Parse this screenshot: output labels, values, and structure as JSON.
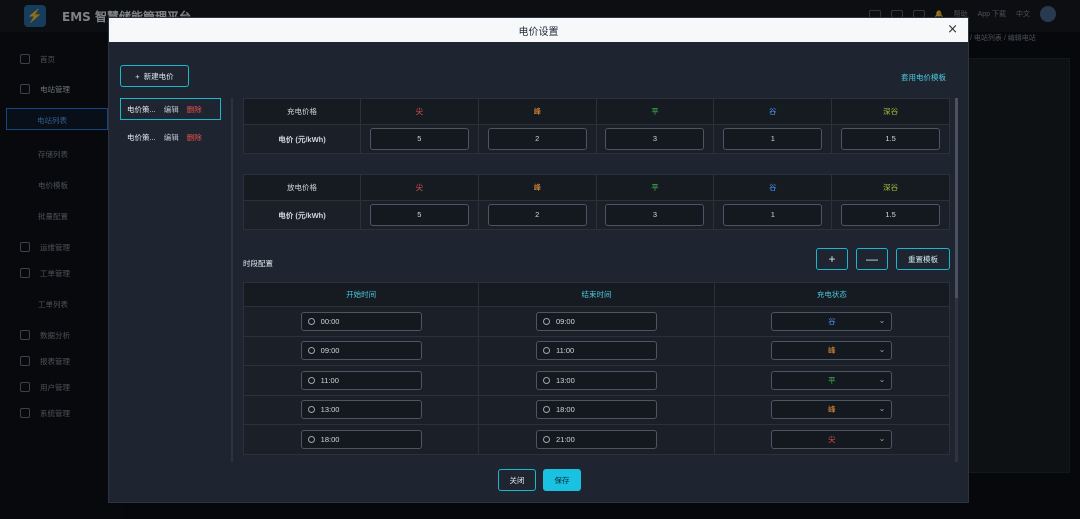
{
  "topbar": {
    "title": "EMS 智慧储能管理平台",
    "buttons": [
      "",
      "",
      ""
    ],
    "help": "帮助",
    "app": "App 下载",
    "lang": "中文"
  },
  "sidebar": {
    "home": "首页",
    "station_mgmt": "电站管理",
    "station_list": "电站列表",
    "storage_list": "存储列表",
    "price_template": "电价模板",
    "batch_config": "批量配置",
    "ops_mgmt": "运维管理",
    "work_order": "工单管理",
    "work_order_list": "工单列表",
    "data_analysis": "数据分析",
    "report_mgmt": "报表管理",
    "user_mgmt": "用户管理",
    "system_mgmt": "系统管理"
  },
  "breadcrumb": "/ 电站列表 / 编辑电站",
  "modal": {
    "title": "电价设置",
    "close": "×",
    "new_price": "新建电价",
    "apply_template": "套用电价模板",
    "price_items": [
      {
        "name": "电价策...",
        "edit": "编辑",
        "delete": "删除"
      },
      {
        "name": "电价策...",
        "edit": "编辑",
        "delete": "删除"
      }
    ],
    "charge_table": {
      "label": "充电价格",
      "row_label": "电价 (元/kWh)",
      "periods": [
        "尖",
        "峰",
        "平",
        "谷",
        "深谷"
      ],
      "values": [
        "5",
        "2",
        "3",
        "1",
        "1.5"
      ]
    },
    "discharge_table": {
      "label": "放电价格",
      "row_label": "电价 (元/kWh)",
      "periods": [
        "尖",
        "峰",
        "平",
        "谷",
        "深谷"
      ],
      "values": [
        "5",
        "2",
        "3",
        "1",
        "1.5"
      ]
    },
    "period_colors": {
      "尖": "#e5534b",
      "峰": "#e8913a",
      "平": "#3fb950",
      "谷": "#4a9eff",
      "深谷": "#a3c43a"
    },
    "segment_title": "时段配置",
    "add_label": "+",
    "remove_label": "—",
    "reset_label": "重置模板",
    "segment_headers": [
      "开始时间",
      "结束时间",
      "充电状态"
    ],
    "segments": [
      {
        "start": "00:00",
        "end": "09:00",
        "state": "谷"
      },
      {
        "start": "09:00",
        "end": "11:00",
        "state": "峰"
      },
      {
        "start": "11:00",
        "end": "13:00",
        "state": "平"
      },
      {
        "start": "13:00",
        "end": "18:00",
        "state": "峰"
      },
      {
        "start": "18:00",
        "end": "21:00",
        "state": "尖"
      }
    ],
    "close_btn": "关闭",
    "save_btn": "保存"
  }
}
